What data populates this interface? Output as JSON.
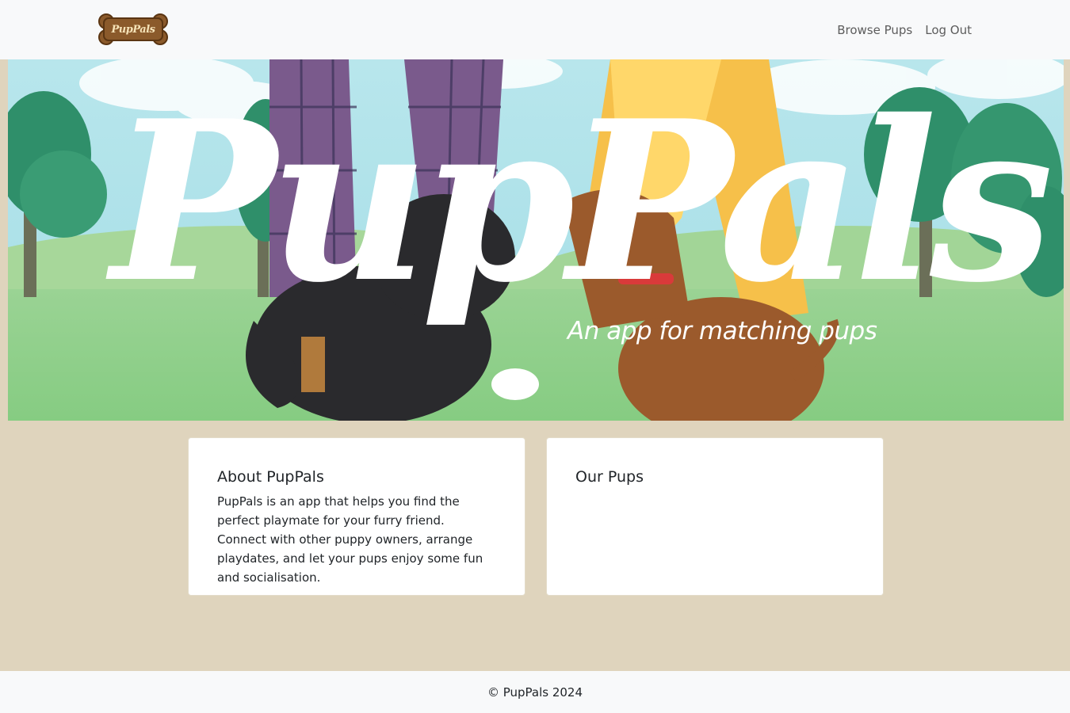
{
  "logo": {
    "text": "PupPals",
    "alt": "PupPals bone logo"
  },
  "nav": {
    "browse_label": "Browse Pups",
    "logout_label": "Log Out"
  },
  "hero": {
    "title": "PupPals",
    "subtitle": "An app for matching pups"
  },
  "about": {
    "title": "About PupPals",
    "text": "PupPals is an app that helps you find the perfect playmate for your furry friend. Connect with other puppy owners, arrange playdates, and let your pups enjoy some fun and socialisation."
  },
  "pups": {
    "title": "Our Pups"
  },
  "footer": {
    "text": "© PupPals 2024"
  },
  "colors": {
    "navbar_bg": "#f8f9fa",
    "page_bg": "#dfd4bd",
    "logo_bone": "#8b5a2b",
    "hero_sky": "#a9e0e8",
    "hero_grass": "#8fd18a"
  }
}
